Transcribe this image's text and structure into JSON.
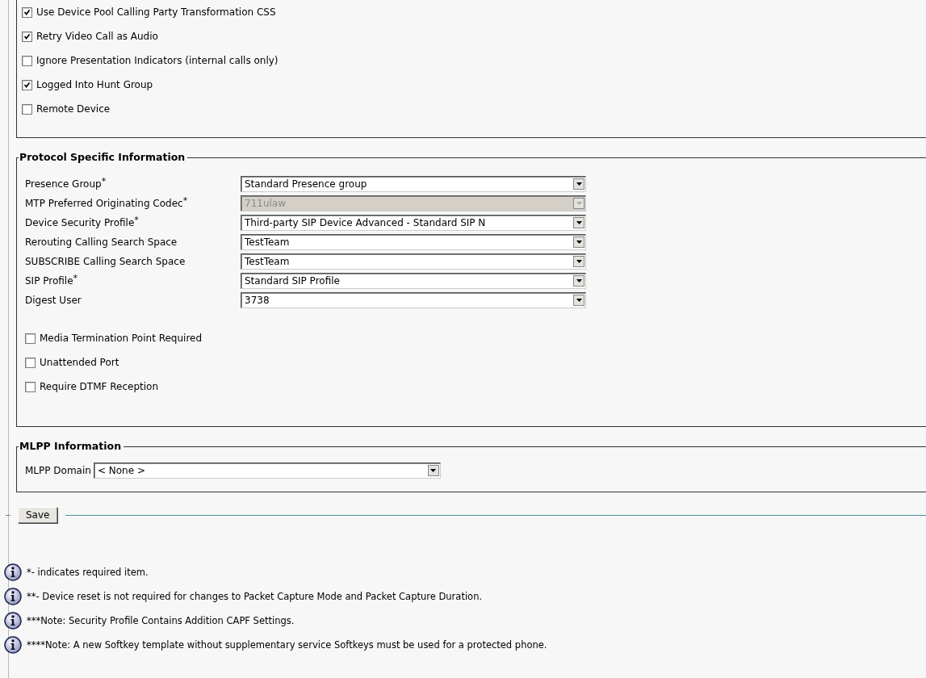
{
  "top_checkboxes": [
    {
      "label": "Use Device Pool Calling Party Transformation CSS",
      "checked": true
    },
    {
      "label": "Retry Video Call as Audio",
      "checked": true
    },
    {
      "label": "Ignore Presentation Indicators (internal calls only)",
      "checked": false
    },
    {
      "label": "Logged Into Hunt Group",
      "checked": true
    },
    {
      "label": "Remote Device",
      "checked": false
    }
  ],
  "protocol": {
    "legend": "Protocol Specific Information",
    "fields": [
      {
        "label": "Presence Group$^{*}$",
        "value": "Standard Presence group",
        "disabled": false
      },
      {
        "label": "MTP Preferred Originating Codec$^{*}$",
        "value": "711ulaw",
        "disabled": true
      },
      {
        "label": "Device Security Profile$^{*}$",
        "value": "Third-party SIP Device Advanced - Standard SIP N",
        "disabled": false
      },
      {
        "label": "Rerouting Calling Search Space",
        "value": "TestTeam",
        "disabled": false
      },
      {
        "label": "SUBSCRIBE Calling Search Space",
        "value": "TestTeam",
        "disabled": false
      },
      {
        "label": "SIP Profile$^{*}$",
        "value": "Standard SIP Profile",
        "disabled": false
      },
      {
        "label": "Digest User",
        "value": "3738",
        "disabled": false
      }
    ],
    "checkboxes": [
      {
        "label": "Media Termination Point Required",
        "checked": false
      },
      {
        "label": "Unattended Port",
        "checked": false
      },
      {
        "label": "Require DTMF Reception",
        "checked": false
      }
    ]
  },
  "mlpp": {
    "legend": "MLPP Information",
    "fields": [
      {
        "label": "MLPP Domain",
        "value": "< None >",
        "disabled": false
      }
    ]
  },
  "save_button": "Save",
  "notes": [
    "*- indicates required item.",
    "**- Device reset is not required for changes to Packet Capture Mode and Packet Capture Duration.",
    "***Note: Security Profile Contains Addition CAPF Settings.",
    "****Note: A new Softkey template without supplementary service Softkeys must be used for a protected phone."
  ]
}
